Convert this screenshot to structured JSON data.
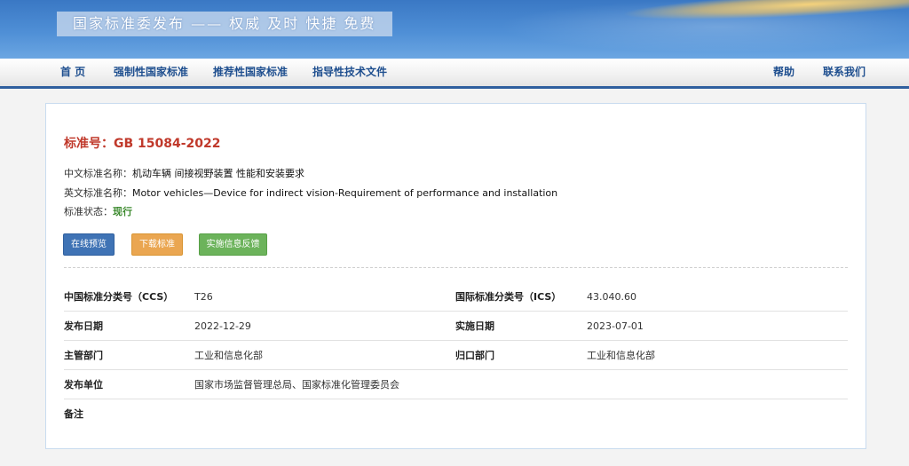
{
  "banner": {
    "title": "国家标准委发布 —— 权威 及时 快捷 免费"
  },
  "nav": {
    "home": "首 页",
    "mandatory": "强制性国家标准",
    "recommended": "推荐性国家标准",
    "guidance": "指导性技术文件",
    "help": "帮助",
    "contact": "联系我们"
  },
  "standard": {
    "number_label": "标准号：",
    "number": "GB 15084-2022",
    "cn_name_label": "中文标准名称：",
    "cn_name": "机动车辆 间接视野装置 性能和安装要求",
    "en_name_label": "英文标准名称：",
    "en_name": "Motor vehicles—Device for indirect vision-Requirement of performance and installation",
    "status_label": "标准状态：",
    "status": "现行"
  },
  "buttons": {
    "preview": "在线预览",
    "download": "下载标准",
    "feedback": "实施信息反馈"
  },
  "details": {
    "ccs_label": "中国标准分类号（CCS）",
    "ccs": "T26",
    "ics_label": "国际标准分类号（ICS）",
    "ics": "43.040.60",
    "publish_date_label": "发布日期",
    "publish_date": "2022-12-29",
    "implement_date_label": "实施日期",
    "implement_date": "2023-07-01",
    "authority_label": "主管部门",
    "authority": "工业和信息化部",
    "centralized_label": "归口部门",
    "centralized": "工业和信息化部",
    "issuer_label": "发布单位",
    "issuer": "国家市场监督管理总局、国家标准化管理委员会",
    "remark_label": "备注",
    "remark": ""
  },
  "colors": {
    "banner_blue": "#3a78c4",
    "nav_text": "#1f4f8f",
    "standard_number": "#c0392b",
    "status_current": "#3c8a2e",
    "btn_preview": "#3f73b5",
    "btn_download": "#eaa651",
    "btn_feedback": "#6cb35b"
  }
}
